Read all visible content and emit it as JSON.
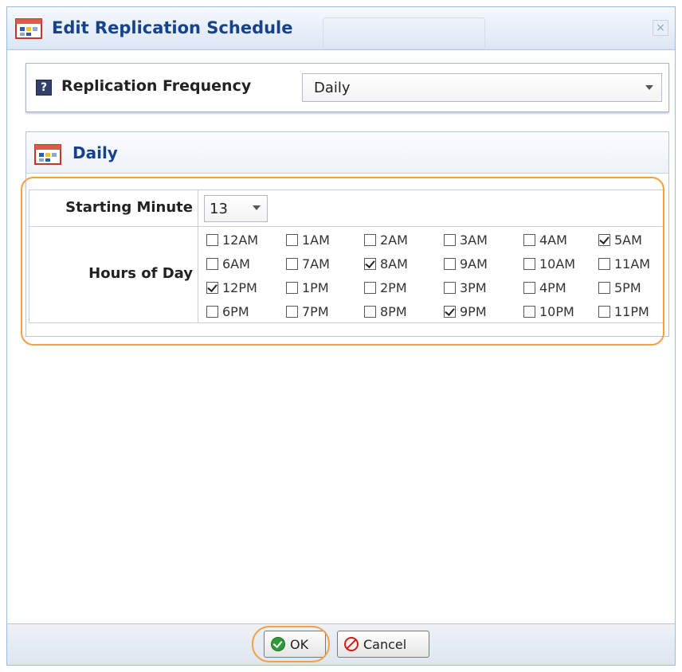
{
  "window": {
    "title": "Edit Replication Schedule",
    "close_glyph": "×"
  },
  "frequency": {
    "help_glyph": "?",
    "label": "Replication Frequency",
    "value": "Daily"
  },
  "daily": {
    "title": "Daily",
    "starting_minute_label": "Starting Minute",
    "starting_minute_value": "13",
    "hours_label": "Hours of Day",
    "hours": [
      {
        "label": "12AM",
        "checked": false
      },
      {
        "label": "1AM",
        "checked": false
      },
      {
        "label": "2AM",
        "checked": false
      },
      {
        "label": "3AM",
        "checked": false
      },
      {
        "label": "4AM",
        "checked": false
      },
      {
        "label": "5AM",
        "checked": true
      },
      {
        "label": "6AM",
        "checked": false
      },
      {
        "label": "7AM",
        "checked": false
      },
      {
        "label": "8AM",
        "checked": true
      },
      {
        "label": "9AM",
        "checked": false
      },
      {
        "label": "10AM",
        "checked": false
      },
      {
        "label": "11AM",
        "checked": false
      },
      {
        "label": "12PM",
        "checked": true
      },
      {
        "label": "1PM",
        "checked": false
      },
      {
        "label": "2PM",
        "checked": false
      },
      {
        "label": "3PM",
        "checked": false
      },
      {
        "label": "4PM",
        "checked": false
      },
      {
        "label": "5PM",
        "checked": false
      },
      {
        "label": "6PM",
        "checked": false
      },
      {
        "label": "7PM",
        "checked": false
      },
      {
        "label": "8PM",
        "checked": false
      },
      {
        "label": "9PM",
        "checked": true
      },
      {
        "label": "10PM",
        "checked": false
      },
      {
        "label": "11PM",
        "checked": false
      }
    ]
  },
  "footer": {
    "ok_label": "OK",
    "cancel_label": "Cancel"
  },
  "colors": {
    "title_text": "#15428b",
    "highlight": "#f5a040",
    "ok_green": "#2f9a3a",
    "cancel_red": "#d01c1c"
  }
}
